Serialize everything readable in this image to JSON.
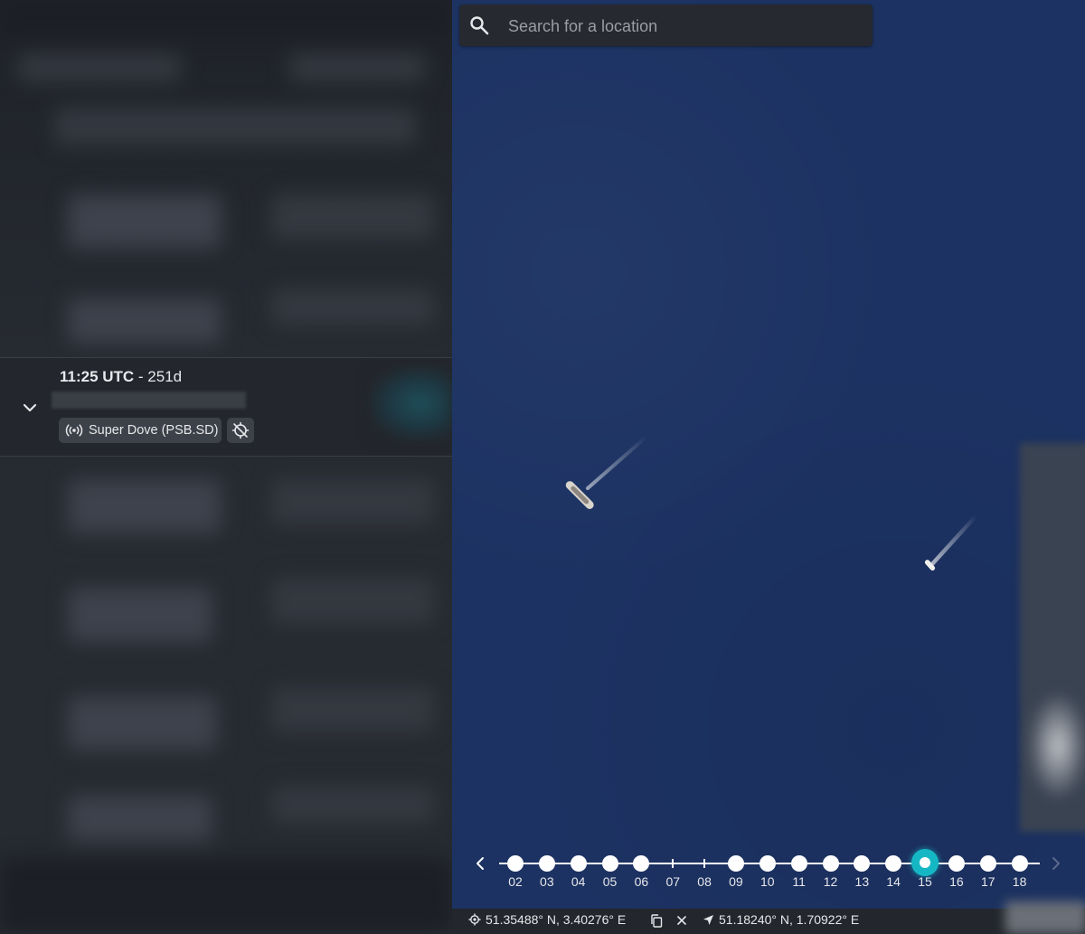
{
  "sidebar": {
    "selected_item": {
      "time": "11:25 UTC",
      "age": " - 251d",
      "satellite_label": "Super Dove (PSB.SD)",
      "icons": {
        "expand": "chevron-down-icon",
        "satellite": "broadcast-icon",
        "location": "crosshair-off-icon"
      }
    }
  },
  "map": {
    "background_color": "#1c3262",
    "search": {
      "placeholder": "Search for a location",
      "icon": "search-icon"
    },
    "timeline": {
      "labels": [
        "02",
        "03",
        "04",
        "05",
        "06",
        "07",
        "08",
        "09",
        "10",
        "11",
        "12",
        "13",
        "14",
        "15",
        "16",
        "17",
        "18"
      ],
      "has_imagery": [
        true,
        true,
        true,
        true,
        true,
        false,
        false,
        true,
        true,
        true,
        true,
        true,
        true,
        true,
        true,
        true,
        true
      ],
      "selected": "15",
      "accent_color": "#16b7c5",
      "prev_icon": "chevron-left-icon",
      "next_icon": "chevron-right-icon"
    }
  },
  "statusbar": {
    "cursor_coords": "51.35488° N, 3.40276° E",
    "cursor_icon": "crosshair-icon",
    "copy_icon": "copy-icon",
    "close_icon": "close-icon",
    "location_icon": "navigation-arrow-icon",
    "my_coords": "51.18240° N, 1.70922° E"
  }
}
